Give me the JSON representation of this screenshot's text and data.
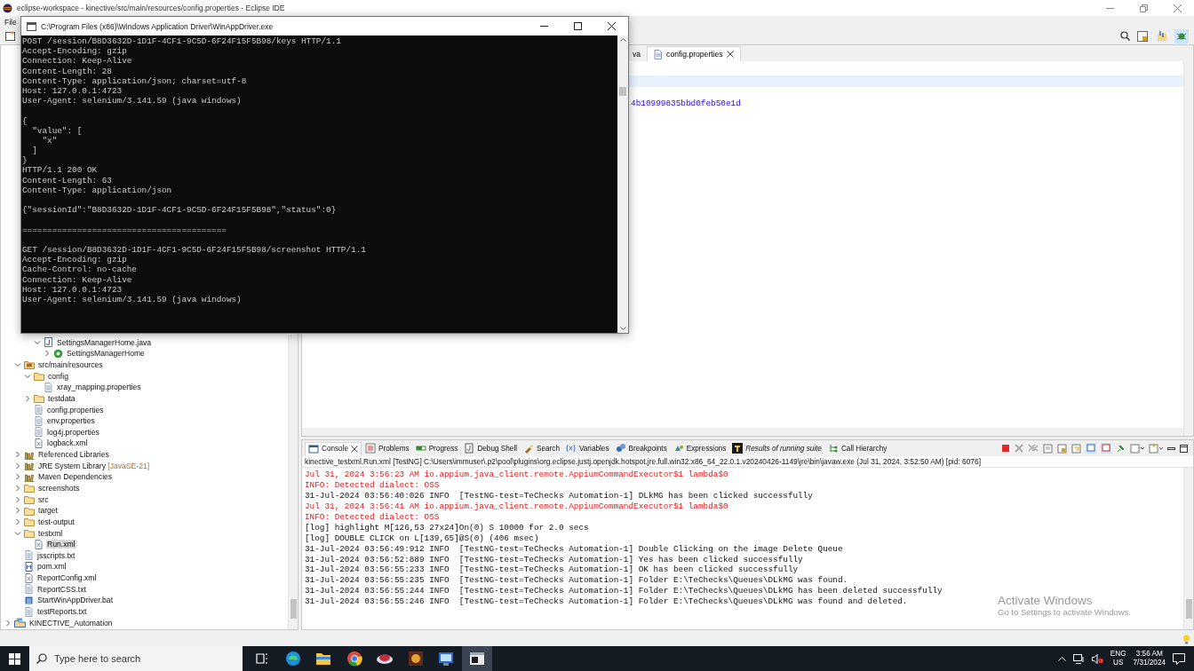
{
  "window": {
    "title": "eclipse-workspace - kinective/src/main/resources/config.properties - Eclipse IDE"
  },
  "menu": [
    {
      "label": "File"
    }
  ],
  "project_explorer": {
    "tree": [
      {
        "children": [
          {
            "children": [
              {
                "children": [
                  {
                    "label": "SettingsManagerHome.java",
                    "kind": "java",
                    "selected": false,
                    "expanded": true,
                    "children": [
                      {
                        "label": "SettingsManagerHome",
                        "kind": "class",
                        "selected": false,
                        "expanded": false
                      }
                    ]
                  }
                ]
              }
            ]
          },
          {
            "label": "src/main/resources",
            "kind": "source-folder",
            "selected": false,
            "expanded": true,
            "children": [
              {
                "label": "config",
                "kind": "folder",
                "selected": false,
                "expanded": true,
                "children": [
                  {
                    "label": "xray_mapping.properties",
                    "kind": "file",
                    "selected": false
                  }
                ]
              },
              {
                "label": "testdata",
                "kind": "folder",
                "selected": false,
                "expanded": false
              },
              {
                "label": "config.properties",
                "kind": "file",
                "selected": false
              },
              {
                "label": "env.properties",
                "kind": "file",
                "selected": false
              },
              {
                "label": "log4j.properties",
                "kind": "file",
                "selected": false
              },
              {
                "label": "logback.xml",
                "kind": "xml",
                "selected": false
              }
            ]
          },
          {
            "label": "Referenced Libraries",
            "kind": "library",
            "selected": false,
            "expanded": false
          },
          {
            "label": "JRE System Library",
            "decoration": "[JavaSE-21]",
            "kind": "library",
            "selected": false,
            "expanded": false
          },
          {
            "label": "Maven Dependencies",
            "kind": "library",
            "selected": false,
            "expanded": false
          },
          {
            "label": "screenshots",
            "kind": "folder",
            "selected": false,
            "expanded": false
          },
          {
            "label": "src",
            "kind": "folder",
            "selected": false,
            "expanded": false
          },
          {
            "label": "target",
            "kind": "folder",
            "selected": false,
            "expanded": false
          },
          {
            "label": "test-output",
            "kind": "folder",
            "selected": false,
            "expanded": false
          },
          {
            "label": "testxml",
            "kind": "folder",
            "selected": false,
            "expanded": true,
            "children": [
              {
                "label": "Run.xml",
                "kind": "xml",
                "selected": true
              }
            ]
          },
          {
            "label": "jsscripts.txt",
            "kind": "file",
            "selected": false
          },
          {
            "label": "pom.xml",
            "kind": "pom",
            "selected": false
          },
          {
            "label": "ReportConfig.xml",
            "kind": "xml",
            "selected": false
          },
          {
            "label": "ReportCSS.txt",
            "kind": "file",
            "selected": false
          },
          {
            "label": "StartWinAppDriver.bat",
            "kind": "bat",
            "selected": false
          },
          {
            "label": "testReports.txt",
            "kind": "file",
            "selected": false
          }
        ]
      },
      {
        "label": "KINECTIVE_Automation",
        "kind": "project",
        "selected": false,
        "expanded": false
      }
    ]
  },
  "editor": {
    "tabs": [
      {
        "label": "va",
        "selected": false,
        "closable": false
      },
      {
        "label": "config.properties",
        "selected": true,
        "closable": true
      }
    ],
    "lines": [
      {
        "current": true
      },
      {
        "current": false
      },
      {
        "text": "4b10999835bbd0feb50e1d",
        "current": false
      }
    ]
  },
  "console_view": {
    "tabs": [
      {
        "label": "Console",
        "kind": "console",
        "selected": true,
        "closable": true,
        "italic": false
      },
      {
        "label": "Problems",
        "kind": "problems",
        "selected": false,
        "closable": false,
        "italic": false
      },
      {
        "label": "Progress",
        "kind": "progress",
        "selected": false,
        "closable": false,
        "italic": false
      },
      {
        "label": "Debug Shell",
        "kind": "debug",
        "selected": false,
        "closable": false,
        "italic": false
      },
      {
        "label": "Search",
        "kind": "search",
        "selected": false,
        "closable": false,
        "italic": false
      },
      {
        "label": "Variables",
        "kind": "variables",
        "selected": false,
        "closable": false,
        "italic": false
      },
      {
        "label": "Breakpoints",
        "kind": "breakpoints",
        "selected": false,
        "closable": false,
        "italic": false
      },
      {
        "label": "Expressions",
        "kind": "expressions",
        "selected": false,
        "closable": false,
        "italic": false
      },
      {
        "label": "Results of running suite",
        "kind": "testng",
        "selected": false,
        "closable": false,
        "italic": true
      },
      {
        "label": "Call Hierarchy",
        "kind": "hierarchy",
        "selected": false,
        "closable": false,
        "italic": false
      }
    ],
    "description": "kinective_testxml.Run.xml [TestNG] C:\\Users\\immuser\\.p2\\pool\\plugins\\org.eclipse.justj.openjdk.hotspot.jre.full.win32.x86_64_22.0.1.v20240426-1149\\jre\\bin\\javaw.exe  (Jul 31, 2024, 3:52:50 AM) [pid: 6076]",
    "log": [
      {
        "kind": "stderr",
        "text": "Jul 31, 2024 3:56:23 AM io.appium.java_client.remote.AppiumCommandExecutor$1 lambda$0"
      },
      {
        "kind": "stderr",
        "text": "INFO: Detected dialect: OSS"
      },
      {
        "kind": "stdout",
        "text": "31-Jul-2024 03:56:40:026 INFO  [TestNG-test=TeChecks Automation-1] DLkMG has been clicked successfully"
      },
      {
        "kind": "stderr",
        "text": "Jul 31, 2024 3:56:41 AM io.appium.java_client.remote.AppiumCommandExecutor$1 lambda$0"
      },
      {
        "kind": "stderr",
        "text": "INFO: Detected dialect: OSS"
      },
      {
        "kind": "stdout",
        "text": "[log] highlight M[126,53 27x24]On(0) S 10000 for 2.0 secs"
      },
      {
        "kind": "stdout",
        "text": "[log] DOUBLE CLICK on L[139,65]@S(0) (406 msec)"
      },
      {
        "kind": "stdout",
        "text": "31-Jul-2024 03:56:49:912 INFO  [TestNG-test=TeChecks Automation-1] Double Clicking on the image Delete Queue"
      },
      {
        "kind": "stdout",
        "text": "31-Jul-2024 03:56:52:889 INFO  [TestNG-test=TeChecks Automation-1] Yes has been clicked successfully"
      },
      {
        "kind": "stdout",
        "text": "31-Jul-2024 03:56:55:233 INFO  [TestNG-test=TeChecks Automation-1] OK has been clicked successfully"
      },
      {
        "kind": "stdout",
        "text": "31-Jul-2024 03:56:55:235 INFO  [TestNG-test=TeChecks Automation-1] Folder E:\\TeChecks\\Queues\\DLkMG was found."
      },
      {
        "kind": "stdout",
        "text": "31-Jul-2024 03:56:55:244 INFO  [TestNG-test=TeChecks Automation-1] Folder E:\\TeChecks\\Queues\\DLkMG has been deleted successfully"
      },
      {
        "kind": "stdout",
        "text": "31-Jul-2024 03:56:55:246 INFO  [TestNG-test=TeChecks Automation-1] Folder E:\\TeChecks\\Queues\\DLkMG was found and deleted."
      }
    ]
  },
  "activation_notice": {
    "title": "Activate Windows",
    "subtitle": "Go to Settings to activate Windows."
  },
  "terminal_window": {
    "title": "C:\\Program Files (x86)\\Windows Application Driver\\WinAppDriver.exe",
    "blocks": [
      [
        "POST /session/B8D3632D-1D1F-4CF1-9C5D-6F24F15F5B98/keys HTTP/1.1",
        "Accept-Encoding: gzip",
        "Connection: Keep-Alive",
        "Content-Length: 28",
        "Content-Type: application/json; charset=utf-8",
        "Host: 127.0.0.1:4723",
        "User-Agent: selenium/3.141.59 (java windows)"
      ],
      [
        "{",
        "  \"value\": [",
        "    \"x\"",
        "  ]",
        "}",
        "HTTP/1.1 200 OK",
        "Content-Length: 63",
        "Content-Type: application/json"
      ],
      [
        "{\"sessionId\":\"B8D3632D-1D1F-4CF1-9C5D-6F24F15F5B98\",\"status\":0}"
      ],
      [
        "========================================="
      ],
      [
        "GET /session/B8D3632D-1D1F-4CF1-9C5D-6F24F15F5B98/screenshot HTTP/1.1",
        "Accept-Encoding: gzip",
        "Cache-Control: no-cache",
        "Connection: Keep-Alive",
        "Host: 127.0.0.1:4723",
        "User-Agent: selenium/3.141.59 (java windows)"
      ]
    ]
  },
  "taskbar": {
    "search": {
      "placeholder": "Type here to search"
    },
    "apps": [
      {
        "kind": "task-view",
        "selected": false
      },
      {
        "kind": "browser",
        "selected": false
      },
      {
        "kind": "files",
        "selected": false
      },
      {
        "kind": "round-browser",
        "selected": false
      },
      {
        "kind": "cloud-app",
        "selected": false
      },
      {
        "kind": "game-app",
        "selected": false
      },
      {
        "kind": "driver-app",
        "selected": false
      },
      {
        "kind": "terminal",
        "selected": true
      }
    ],
    "language": "ENG",
    "region": "US",
    "time": "3:56 AM",
    "date": "7/31/2024"
  }
}
